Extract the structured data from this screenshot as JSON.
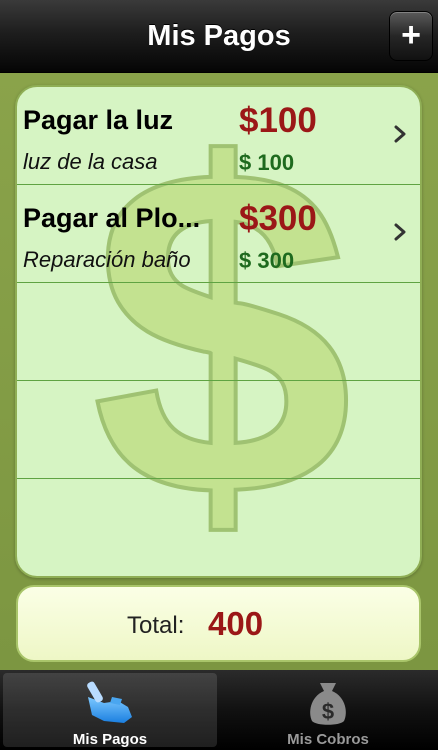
{
  "navbar": {
    "title": "Mis Pagos",
    "add_label": "+"
  },
  "payments": [
    {
      "title": "Pagar la luz",
      "subtitle": "luz de la casa",
      "amount": "$100",
      "amount_secondary": "$ 100"
    },
    {
      "title": "Pagar al Plo...",
      "subtitle": "Reparación baño",
      "amount": "$300",
      "amount_secondary": "$ 300"
    }
  ],
  "total": {
    "label": "Total:",
    "value": "400"
  },
  "tabs": [
    {
      "label": "Mis Pagos",
      "icon": "pay-hand-icon",
      "active": true
    },
    {
      "label": "Mis Cobros",
      "icon": "money-bag-icon",
      "active": false
    }
  ],
  "colors": {
    "amount_red": "#9b1717",
    "amount_green": "#1e6a1e",
    "list_background": "#d6f4c3",
    "frame_green": "#7c9641"
  }
}
